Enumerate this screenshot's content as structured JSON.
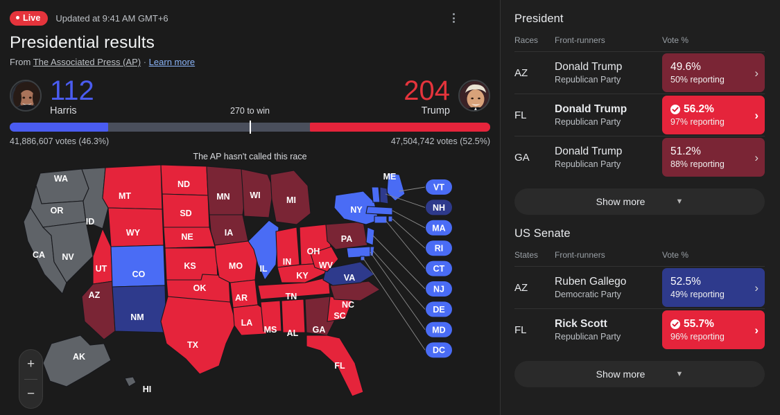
{
  "header": {
    "live_label": "Live",
    "updated": "Updated at 9:41 AM GMT+6",
    "title": "Presidential results",
    "source_prefix": "From",
    "source_link": "The Associated Press (AP)",
    "separator": "·",
    "learn_more": "Learn more",
    "menu_icon": "kebab-menu-icon"
  },
  "scoreboard": {
    "to_win": "270 to win",
    "called_status": "The AP hasn't called this race",
    "democrat": {
      "name": "Harris",
      "electoral_votes": "112",
      "votes_text": "41,886,607 votes (46.3%)",
      "color": "#4a5cf0",
      "bar_pct": 20.5
    },
    "republican": {
      "name": "Trump",
      "electoral_votes": "204",
      "votes_text": "47,504,742 votes (52.5%)",
      "color": "#e5243b",
      "bar_pct": 37.5
    }
  },
  "map": {
    "zoom_in": "+",
    "zoom_out": "−",
    "legend_colors": {
      "rep_strong": "#e5243b",
      "rep_lean": "#7a2535",
      "dem_strong": "#4a6cf5",
      "dem_lean": "#2e3a8c",
      "no_result": "#5f6368"
    },
    "callouts": [
      {
        "abbr": "VT",
        "tone": "dem_strong"
      },
      {
        "abbr": "NH",
        "tone": "dem_lean"
      },
      {
        "abbr": "MA",
        "tone": "dem_strong"
      },
      {
        "abbr": "RI",
        "tone": "dem_strong"
      },
      {
        "abbr": "CT",
        "tone": "dem_strong"
      },
      {
        "abbr": "NJ",
        "tone": "dem_strong"
      },
      {
        "abbr": "DE",
        "tone": "dem_strong"
      },
      {
        "abbr": "MD",
        "tone": "dem_strong"
      },
      {
        "abbr": "DC",
        "tone": "dem_strong"
      }
    ],
    "states": [
      {
        "abbr": "WA",
        "tone": "no_result"
      },
      {
        "abbr": "OR",
        "tone": "no_result"
      },
      {
        "abbr": "ID",
        "tone": "no_result"
      },
      {
        "abbr": "NV",
        "tone": "no_result"
      },
      {
        "abbr": "CA",
        "tone": "no_result"
      },
      {
        "abbr": "MT",
        "tone": "rep_strong"
      },
      {
        "abbr": "WY",
        "tone": "rep_strong"
      },
      {
        "abbr": "UT",
        "tone": "rep_strong"
      },
      {
        "abbr": "AZ",
        "tone": "rep_lean"
      },
      {
        "abbr": "CO",
        "tone": "dem_strong"
      },
      {
        "abbr": "NM",
        "tone": "dem_lean"
      },
      {
        "abbr": "ND",
        "tone": "rep_strong"
      },
      {
        "abbr": "SD",
        "tone": "rep_strong"
      },
      {
        "abbr": "NE",
        "tone": "rep_strong"
      },
      {
        "abbr": "KS",
        "tone": "rep_strong"
      },
      {
        "abbr": "OK",
        "tone": "rep_strong"
      },
      {
        "abbr": "TX",
        "tone": "rep_strong"
      },
      {
        "abbr": "MN",
        "tone": "rep_lean"
      },
      {
        "abbr": "IA",
        "tone": "rep_lean"
      },
      {
        "abbr": "MO",
        "tone": "rep_strong"
      },
      {
        "abbr": "AR",
        "tone": "rep_strong"
      },
      {
        "abbr": "LA",
        "tone": "rep_strong"
      },
      {
        "abbr": "WI",
        "tone": "rep_lean"
      },
      {
        "abbr": "IL",
        "tone": "dem_strong"
      },
      {
        "abbr": "MI",
        "tone": "rep_lean"
      },
      {
        "abbr": "IN",
        "tone": "rep_strong"
      },
      {
        "abbr": "OH",
        "tone": "rep_strong"
      },
      {
        "abbr": "KY",
        "tone": "rep_strong"
      },
      {
        "abbr": "TN",
        "tone": "rep_strong"
      },
      {
        "abbr": "MS",
        "tone": "rep_strong"
      },
      {
        "abbr": "AL",
        "tone": "rep_strong"
      },
      {
        "abbr": "GA",
        "tone": "rep_lean"
      },
      {
        "abbr": "FL",
        "tone": "rep_strong"
      },
      {
        "abbr": "SC",
        "tone": "rep_strong"
      },
      {
        "abbr": "NC",
        "tone": "rep_lean"
      },
      {
        "abbr": "VA",
        "tone": "dem_lean"
      },
      {
        "abbr": "WV",
        "tone": "rep_strong"
      },
      {
        "abbr": "PA",
        "tone": "rep_lean"
      },
      {
        "abbr": "NY",
        "tone": "dem_strong"
      },
      {
        "abbr": "ME",
        "tone": "dem_strong"
      },
      {
        "abbr": "AK",
        "tone": "no_result"
      },
      {
        "abbr": "HI",
        "tone": "no_result"
      }
    ]
  },
  "president": {
    "title": "President",
    "col_races": "Races",
    "col_front": "Front-runners",
    "col_vote": "Vote %",
    "show_more": "Show more",
    "rows": [
      {
        "state": "AZ",
        "candidate": "Donald Trump",
        "party": "Republican Party",
        "pct": "49.6%",
        "reporting": "50% reporting",
        "called": false,
        "tone": "rep_lean"
      },
      {
        "state": "FL",
        "candidate": "Donald Trump",
        "party": "Republican Party",
        "pct": "56.2%",
        "reporting": "97% reporting",
        "called": true,
        "tone": "rep_strong"
      },
      {
        "state": "GA",
        "candidate": "Donald Trump",
        "party": "Republican Party",
        "pct": "51.2%",
        "reporting": "88% reporting",
        "called": false,
        "tone": "rep_lean"
      }
    ]
  },
  "senate": {
    "title": "US Senate",
    "col_races": "States",
    "col_front": "Front-runners",
    "col_vote": "Vote %",
    "show_more": "Show more",
    "rows": [
      {
        "state": "AZ",
        "candidate": "Ruben Gallego",
        "party": "Democratic Party",
        "pct": "52.5%",
        "reporting": "49% reporting",
        "called": false,
        "tone": "dem_lean"
      },
      {
        "state": "FL",
        "candidate": "Rick Scott",
        "party": "Republican Party",
        "pct": "55.7%",
        "reporting": "96% reporting",
        "called": true,
        "tone": "rep_strong"
      }
    ]
  }
}
